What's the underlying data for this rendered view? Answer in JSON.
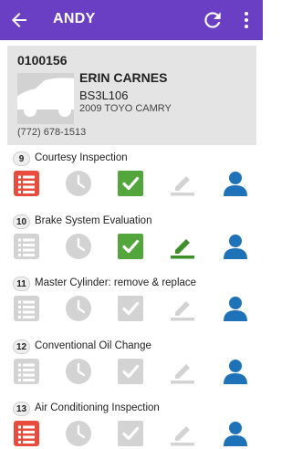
{
  "header": {
    "title": "ANDY"
  },
  "customer": {
    "ro_number": "0100156",
    "name": "ERIN CARNES",
    "plate": "BS3L106",
    "vehicle": "2009 TOYO CAMRY",
    "phone": "(772) 678-1513"
  },
  "jobs": [
    {
      "number": "9",
      "title": "Courtesy Inspection",
      "checklist": true,
      "completed": true,
      "note_active": false
    },
    {
      "number": "10",
      "title": "Brake System Evaluation",
      "checklist": false,
      "completed": true,
      "note_active": true
    },
    {
      "number": "11",
      "title": "Master Cylinder: remove & replace",
      "checklist": false,
      "completed": false,
      "note_active": false
    },
    {
      "number": "12",
      "title": "Conventional Oil Change",
      "checklist": false,
      "completed": false,
      "note_active": false
    },
    {
      "number": "13",
      "title": "Air Conditioning Inspection",
      "checklist": true,
      "completed": false,
      "note_active": false
    }
  ],
  "icons": {
    "back": "arrow-left-icon",
    "refresh": "refresh-icon",
    "more": "more-vert-icon",
    "checklist": "checklist-icon",
    "clock": "clock-icon",
    "check": "check-icon",
    "pencil": "pencil-icon",
    "technician": "person-icon"
  },
  "colors": {
    "appbar": "#6a3fc4",
    "checklist": "#e74c3c",
    "completed": "#53a63c",
    "note_active": "#3e8e2c",
    "technician": "#1d72b8",
    "inactive": "#d3d3d3"
  }
}
